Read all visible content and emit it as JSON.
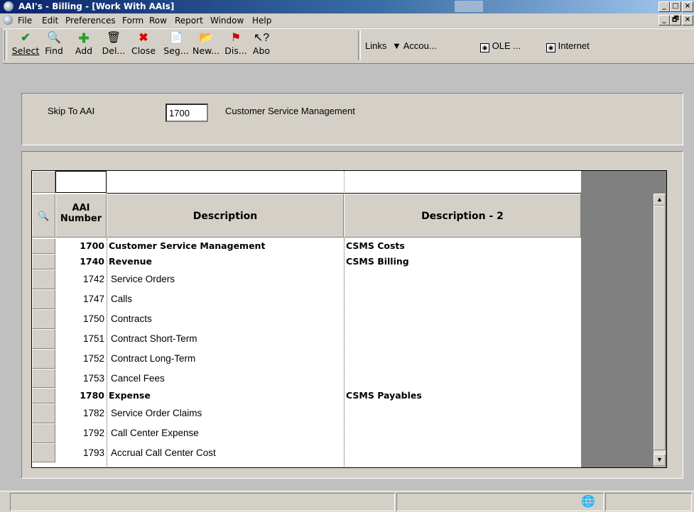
{
  "window": {
    "title": "AAI's - Billing - [Work With AAIs]",
    "minimize": "_",
    "maximize": "□",
    "close": "×",
    "child_minimize": "_",
    "child_restore": "🗗",
    "child_close": "×"
  },
  "menu": [
    "File",
    "Edit",
    "Preferences",
    "Form",
    "Row",
    "Report",
    "Window",
    "Help"
  ],
  "toolbar": {
    "buttons": [
      {
        "label": "Select",
        "icon": "check-icon"
      },
      {
        "label": "Find",
        "icon": "find-icon"
      },
      {
        "label": "Add",
        "icon": "plus-icon"
      },
      {
        "label": "Del...",
        "icon": "trash-icon"
      },
      {
        "label": "Close",
        "icon": "close-icon"
      },
      {
        "label": "Seg...",
        "icon": "segment-icon"
      },
      {
        "label": "New...",
        "icon": "new-icon"
      },
      {
        "label": "Dis...",
        "icon": "display-icon"
      },
      {
        "label": "Abo",
        "icon": "help-arrow-icon"
      }
    ],
    "links_label": "Links",
    "accounts_label": "Accou...",
    "ole_label": "OLE ...",
    "internet_label": "Internet"
  },
  "skip_to": {
    "label": "Skip To AAI",
    "value": "1700",
    "description": "Customer Service Management"
  },
  "grid": {
    "headers": {
      "aai_number_line1": "AAI",
      "aai_number_line2": "Number",
      "description": "Description",
      "description2": "Description - 2"
    },
    "rows": [
      {
        "number": "1700",
        "description": "Customer Service Management",
        "description2": "CSMS Costs",
        "bold": true
      },
      {
        "number": "1740",
        "description": "Revenue",
        "description2": "CSMS Billing",
        "bold": true
      },
      {
        "number": "1742",
        "description": "Service Orders",
        "description2": "",
        "bold": false
      },
      {
        "number": "1747",
        "description": "Calls",
        "description2": "",
        "bold": false
      },
      {
        "number": "1750",
        "description": "Contracts",
        "description2": "",
        "bold": false
      },
      {
        "number": "1751",
        "description": "Contract Short-Term",
        "description2": "",
        "bold": false
      },
      {
        "number": "1752",
        "description": "Contract Long-Term",
        "description2": "",
        "bold": false
      },
      {
        "number": "1753",
        "description": "Cancel Fees",
        "description2": "",
        "bold": false
      },
      {
        "number": "1780",
        "description": "Expense",
        "description2": "CSMS Payables",
        "bold": true
      },
      {
        "number": "1782",
        "description": "Service Order Claims",
        "description2": "",
        "bold": false
      },
      {
        "number": "1792",
        "description": "Call Center Expense",
        "description2": "",
        "bold": false
      },
      {
        "number": "1793",
        "description": "Accrual Call Center Cost",
        "description2": "",
        "bold": false
      }
    ]
  }
}
